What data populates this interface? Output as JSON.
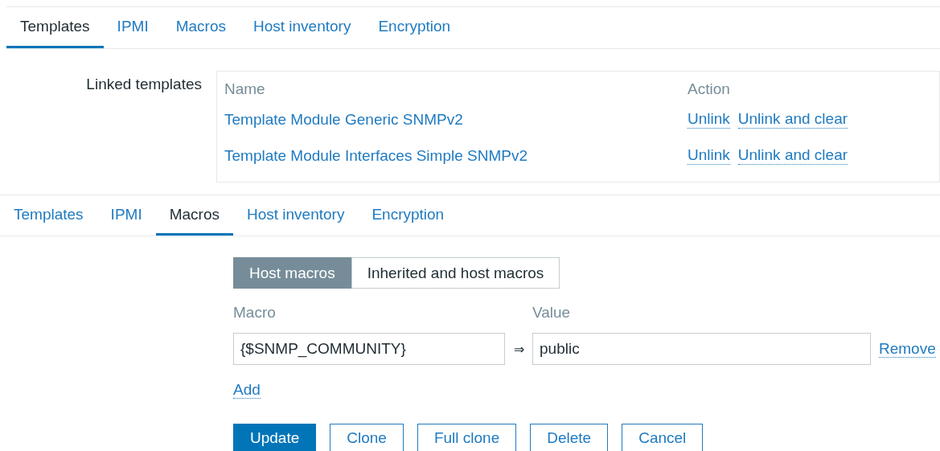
{
  "tab_bars": [
    {
      "tabs": [
        {
          "label": "Templates",
          "selected": true
        },
        {
          "label": "IPMI",
          "selected": false
        },
        {
          "label": "Macros",
          "selected": false
        },
        {
          "label": "Host inventory",
          "selected": false
        },
        {
          "label": "Encryption",
          "selected": false
        }
      ]
    },
    {
      "tabs": [
        {
          "label": "Templates",
          "selected": false
        },
        {
          "label": "IPMI",
          "selected": false
        },
        {
          "label": "Macros",
          "selected": true
        },
        {
          "label": "Host inventory",
          "selected": false
        },
        {
          "label": "Encryption",
          "selected": false
        }
      ]
    }
  ],
  "linked_templates": {
    "label": "Linked templates",
    "columns": [
      "Name",
      "Action"
    ],
    "rows": [
      {
        "name": "Template Module Generic SNMPv2",
        "actions": [
          "Unlink",
          "Unlink and clear"
        ]
      },
      {
        "name": "Template Module Interfaces Simple SNMPv2",
        "actions": [
          "Unlink",
          "Unlink and clear"
        ]
      }
    ]
  },
  "macros": {
    "toggle": [
      {
        "label": "Host macros",
        "selected": true
      },
      {
        "label": "Inherited and host macros",
        "selected": false
      }
    ],
    "columns": [
      "Macro",
      "Value"
    ],
    "rows": [
      {
        "macro": "{$SNMP_COMMUNITY}",
        "arrow": "⇒",
        "value": "public",
        "remove": "Remove"
      }
    ],
    "add": "Add"
  },
  "buttons": [
    {
      "label": "Update",
      "primary": true
    },
    {
      "label": "Clone",
      "primary": false
    },
    {
      "label": "Full clone",
      "primary": false
    },
    {
      "label": "Delete",
      "primary": false
    },
    {
      "label": "Cancel",
      "primary": false
    }
  ]
}
